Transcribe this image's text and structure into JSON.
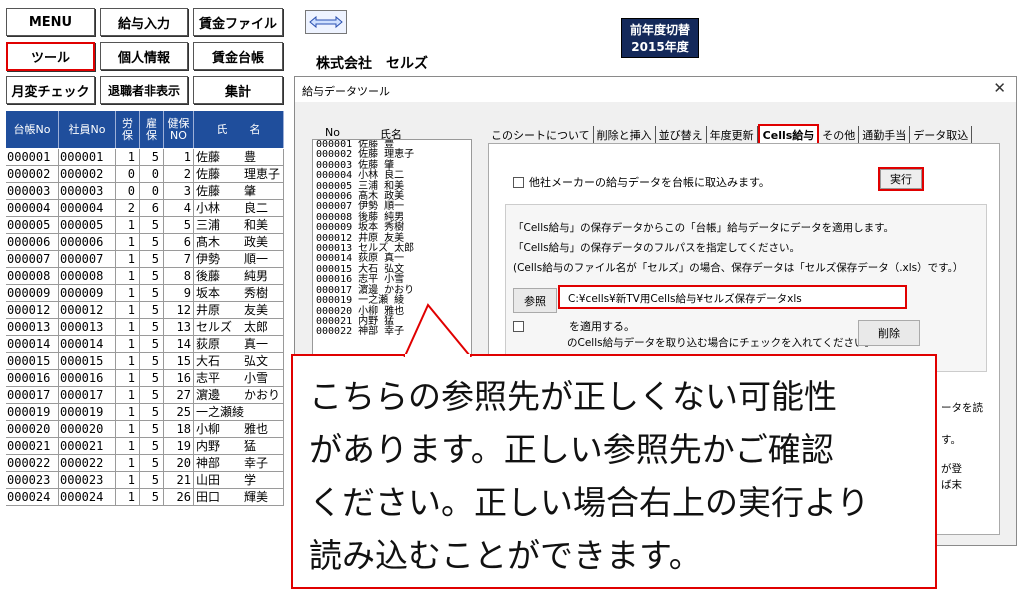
{
  "menu": {
    "menu": "MENU",
    "salary_input": "給与入力",
    "wage_file": "賃金ファイル",
    "tool": "ツール",
    "personal_info": "個人情報",
    "wage_ledger": "賃金台帳",
    "monthly_check": "月変チェック",
    "hide_retired": "退職者非表示",
    "total": "集計"
  },
  "company_name": "株式会社　セルズ",
  "prev_year_switch": {
    "line1": "前年度切替",
    "line2": "2015年度"
  },
  "table": {
    "headers": [
      "台帳No",
      "社員No",
      "労保",
      "雇保",
      "健保NO",
      "氏　　名"
    ],
    "rows": [
      [
        "000001",
        "000001",
        "1",
        "5",
        "1",
        "佐藤　　豊"
      ],
      [
        "000002",
        "000002",
        "0",
        "0",
        "2",
        "佐藤　　理恵子"
      ],
      [
        "000003",
        "000003",
        "0",
        "0",
        "3",
        "佐藤　　肇"
      ],
      [
        "000004",
        "000004",
        "2",
        "6",
        "4",
        "小林　　良二"
      ],
      [
        "000005",
        "000005",
        "1",
        "5",
        "5",
        "三浦　　和美"
      ],
      [
        "000006",
        "000006",
        "1",
        "5",
        "6",
        "髙木　　政美"
      ],
      [
        "000007",
        "000007",
        "1",
        "5",
        "7",
        "伊勢　　順一"
      ],
      [
        "000008",
        "000008",
        "1",
        "5",
        "8",
        "後藤　　純男"
      ],
      [
        "000009",
        "000009",
        "1",
        "5",
        "9",
        "坂本　　秀樹"
      ],
      [
        "000012",
        "000012",
        "1",
        "5",
        "12",
        "井原　　友美"
      ],
      [
        "000013",
        "000013",
        "1",
        "5",
        "13",
        "セルズ　太郎"
      ],
      [
        "000014",
        "000014",
        "1",
        "5",
        "14",
        "荻原　　真一"
      ],
      [
        "000015",
        "000015",
        "1",
        "5",
        "15",
        "大石　　弘文"
      ],
      [
        "000016",
        "000016",
        "1",
        "5",
        "16",
        "志平　　小雪"
      ],
      [
        "000017",
        "000017",
        "1",
        "5",
        "27",
        "濵邊　　かおり"
      ],
      [
        "000019",
        "000019",
        "1",
        "5",
        "25",
        "一之瀬綾"
      ],
      [
        "000020",
        "000020",
        "1",
        "5",
        "18",
        "小柳　　雅也"
      ],
      [
        "000021",
        "000021",
        "1",
        "5",
        "19",
        "内野　　猛"
      ],
      [
        "000022",
        "000022",
        "1",
        "5",
        "20",
        "神部　　幸子"
      ],
      [
        "000023",
        "000023",
        "1",
        "5",
        "21",
        "山田　　学"
      ],
      [
        "000024",
        "000024",
        "1",
        "5",
        "26",
        "田口　　輝美"
      ]
    ]
  },
  "dialog": {
    "title": "給与データツール",
    "close": "✕",
    "list_header_no": "No",
    "list_header_name": "氏名",
    "list": [
      "000001 佐藤 豊",
      "000002 佐藤 理恵子",
      "000003 佐藤 肇",
      "000004 小林 良二",
      "000005 三浦 和美",
      "000006 髙木 政美",
      "000007 伊勢 順一",
      "000008 後藤 純男",
      "000009 坂本 秀樹",
      "000012 井原 友美",
      "000013 セルズ 太郎",
      "000014 荻原 真一",
      "000015 大石 弘文",
      "000016 志平 小雪",
      "000017 濵邊 かおり",
      "000019 一之瀬 綾",
      "000020 小柳 雅也",
      "000021 内野 猛",
      "000022 神部 幸子"
    ],
    "tabs": [
      "このシートについて",
      "削除と挿入",
      "並び替え",
      "年度更新",
      "Cells給与",
      "その他",
      "通勤手当",
      "データ取込"
    ],
    "active_tab": "Cells給与",
    "import_other_check": "他社メーカーの給与データを台帳に取込みます。",
    "exec_button": "実行",
    "desc1": "「Cells給与」の保存データからこの「台帳」給与データにデータを適用します。",
    "desc2": "「Cells給与」の保存データのフルパスを指定してください。",
    "desc3": "(Cells給与のファイル名が「セルズ」の場合、保存データは「セルズ保存データ（.xls）です。）",
    "ref_button": "参照",
    "path_value": "C:¥cells¥新TV用Cells給与¥セルズ保存データxls",
    "apply_check": "を適用する。",
    "partial_note": "のCells給与データを取り込む場合にチェックを入れてください。",
    "delete_button": "削除",
    "right_fragment1": "ータを読",
    "right_fragment2": "す。",
    "right_fragment3": "が登",
    "right_fragment4": "ば末"
  },
  "callout": {
    "line1": "こちらの参照先が正しくない可能性",
    "line2": "があります。正しい参照先かご確認",
    "line3": "ください。正しい場合右上の実行より",
    "line4": "読み込むことができます。"
  },
  "colors": {
    "header_blue": "#1f4e9c",
    "highlight_red": "#e00000",
    "switch_navy": "#14295a"
  }
}
